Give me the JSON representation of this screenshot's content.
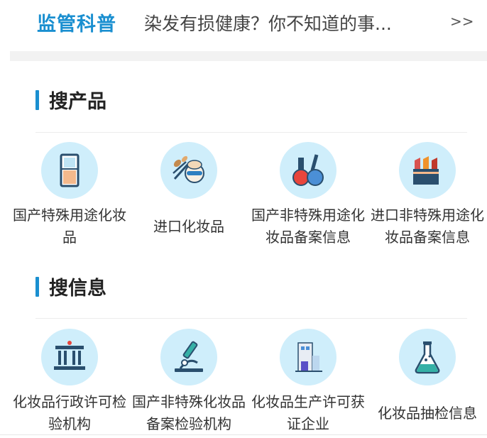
{
  "news": {
    "tag": "监管科普",
    "title": "染发有损健康？你不知道的事...",
    "more": ">>"
  },
  "sections": [
    {
      "title": "搜产品",
      "items": [
        {
          "label": "国产特殊用途化妆品",
          "icon": "foundation-compact-icon"
        },
        {
          "label": "进口化妆品",
          "icon": "makeup-brush-icon"
        },
        {
          "label": "国产非特殊用途化妆品备案信息",
          "icon": "nail-polish-icon"
        },
        {
          "label": "进口非特殊用途化妆品备案信息",
          "icon": "lipstick-icon"
        }
      ]
    },
    {
      "title": "搜信息",
      "items": [
        {
          "label": "化妆品行政许可检验机构",
          "icon": "institution-building-icon"
        },
        {
          "label": "国产非特殊化妆品备案检验机构",
          "icon": "microscope-icon"
        },
        {
          "label": "化妆品生产许可获证企业",
          "icon": "factory-icon"
        },
        {
          "label": "化妆品抽检信息",
          "icon": "flask-icon"
        }
      ]
    }
  ],
  "colors": {
    "accent": "#1a8fd0",
    "icon_bg": "#cfeefb"
  }
}
